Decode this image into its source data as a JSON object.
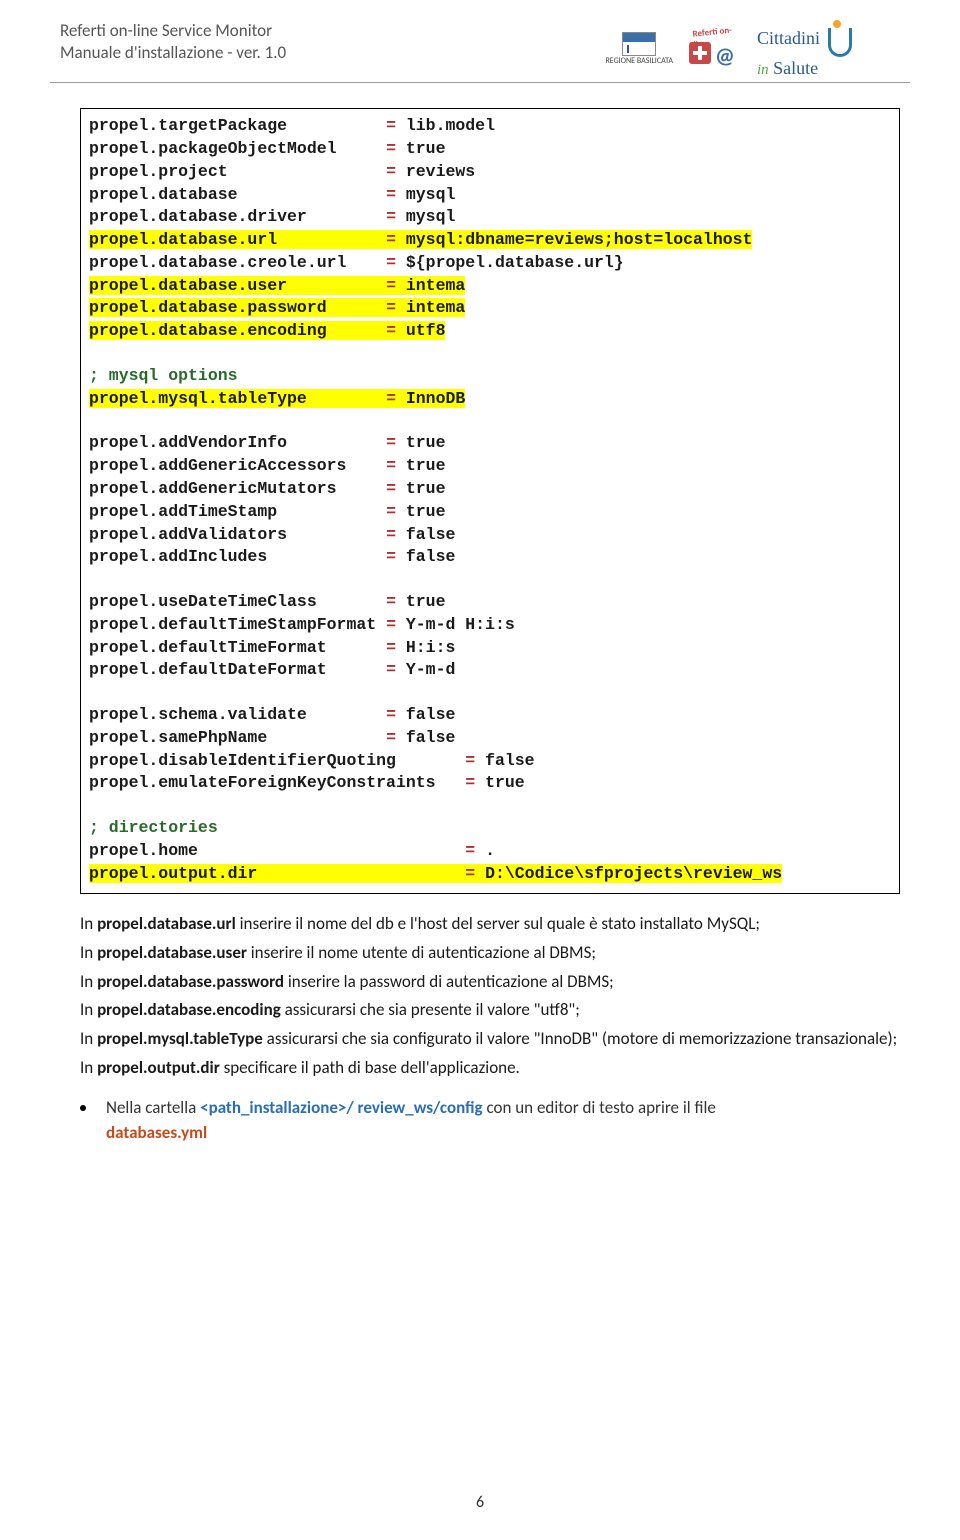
{
  "header": {
    "line1": "Referti on-line Service Monitor",
    "line2": "Manuale d'installazione - ver. 1.0",
    "basilicata_label": "REGIONE BASILICATA",
    "referti_arc": "Referti on-line",
    "cittadini_top": "Cittadini",
    "cittadini_in": "in",
    "cittadini_bot": "Salute"
  },
  "code": {
    "lines": [
      {
        "k": "propel.targetPackage",
        "v": "lib.model",
        "hl": false
      },
      {
        "k": "propel.packageObjectModel",
        "v": "true",
        "hl": false
      },
      {
        "k": "propel.project",
        "v": "reviews",
        "hl": false
      },
      {
        "k": "propel.database",
        "v": "mysql",
        "hl": false
      },
      {
        "k": "propel.database.driver",
        "v": "mysql",
        "hl": false
      },
      {
        "k": "propel.database.url",
        "v": "mysql:dbname=reviews;host=localhost",
        "hl": true
      },
      {
        "k": "propel.database.creole.url",
        "v": "${propel.database.url}",
        "hl": false
      },
      {
        "k": "propel.database.user",
        "v": "intema",
        "hl": true
      },
      {
        "k": "propel.database.password",
        "v": "intema",
        "hl": true
      },
      {
        "k": "propel.database.encoding",
        "v": "utf8",
        "hl": true
      },
      {
        "type": "blank"
      },
      {
        "type": "comment",
        "text": "; mysql options"
      },
      {
        "k": "propel.mysql.tableType",
        "v": "InnoDB",
        "hl": true
      },
      {
        "type": "blank"
      },
      {
        "k": "propel.addVendorInfo",
        "v": "true",
        "hl": false
      },
      {
        "k": "propel.addGenericAccessors",
        "v": "true",
        "hl": false
      },
      {
        "k": "propel.addGenericMutators",
        "v": "true",
        "hl": false
      },
      {
        "k": "propel.addTimeStamp",
        "v": "true",
        "hl": false
      },
      {
        "k": "propel.addValidators",
        "v": "false",
        "hl": false
      },
      {
        "k": "propel.addIncludes",
        "v": "false",
        "hl": false
      },
      {
        "type": "blank"
      },
      {
        "k": "propel.useDateTimeClass",
        "v": "true",
        "hl": false
      },
      {
        "k": "propel.defaultTimeStampFormat",
        "v": "Y-m-d H:i:s",
        "hl": false
      },
      {
        "k": "propel.defaultTimeFormat",
        "v": "H:i:s",
        "hl": false
      },
      {
        "k": "propel.defaultDateFormat",
        "v": "Y-m-d",
        "hl": false
      },
      {
        "type": "blank"
      },
      {
        "k": "propel.schema.validate",
        "v": "false",
        "hl": false
      },
      {
        "k": "propel.samePhpName",
        "v": "false",
        "hl": false
      },
      {
        "k": "propel.disableIdentifierQuoting",
        "v": "false",
        "hl": false,
        "eqcol": 38
      },
      {
        "k": "propel.emulateForeignKeyConstraints",
        "v": "true",
        "hl": false,
        "eqcol": 38
      },
      {
        "type": "blank"
      },
      {
        "type": "comment",
        "text": "; directories"
      },
      {
        "k": "propel.home",
        "v": ".",
        "hl": false,
        "eqcol": 38
      },
      {
        "k": "propel.output.dir",
        "v": "D:\\Codice\\sfprojects\\review_ws",
        "hl": true,
        "eqcol": 38
      }
    ],
    "default_eqcol": 30
  },
  "body": {
    "p1_a": "In ",
    "p1_b": "propel.database.url",
    "p1_c": " inserire il nome del db e l'host del server sul quale è stato installato MySQL;",
    "p2_a": "In ",
    "p2_b": "propel.database.user",
    "p2_c": " inserire il nome utente di autenticazione al DBMS;",
    "p3_a": "In ",
    "p3_b": "propel.database.password",
    "p3_c": " inserire la password di autenticazione al DBMS;",
    "p4_a": "In ",
    "p4_b": "propel.database.encoding",
    "p4_c": " assicurarsi che sia presente il valore \"utf8\";",
    "p5_a": "In ",
    "p5_b": "propel.mysql.tableType",
    "p5_c": " assicurarsi che sia configurato il valore \"InnoDB\" (motore di memorizzazione transazionale);",
    "p6_a": "In ",
    "p6_b": "propel.output.dir",
    "p6_c": " specificare il path di base dell'applicazione.",
    "bullet_a": "Nella cartella ",
    "bullet_path": "<path_installazione>/ review_ws/config",
    "bullet_b": " con un editor di testo aprire il file ",
    "bullet_file": "databases.yml"
  },
  "page_number": "6"
}
